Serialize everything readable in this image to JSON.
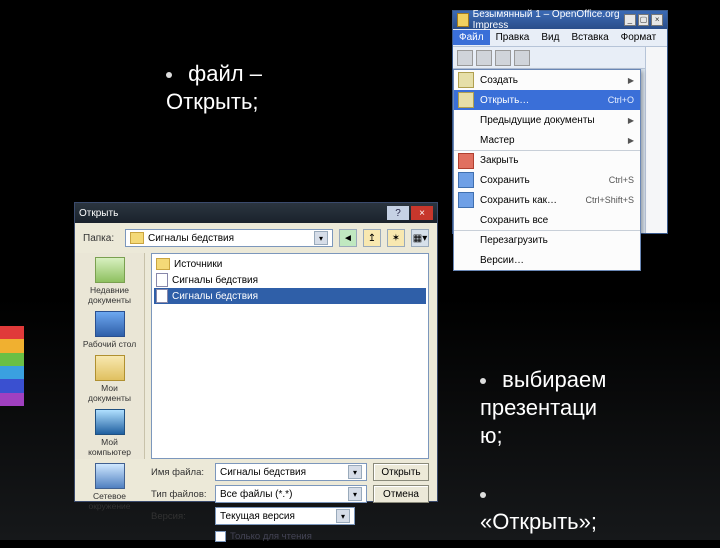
{
  "bullets": {
    "top_line1": "файл –",
    "top_line2": "Открыть;",
    "bottom1_line1": "выбираем",
    "bottom1_line2": "презентаци",
    "bottom1_line3": "ю;",
    "bottom2": "«Открыть»;"
  },
  "app": {
    "title": "Безымянный 1 – OpenOffice.org Impress",
    "menubar": [
      "Файл",
      "Правка",
      "Вид",
      "Вставка",
      "Формат"
    ],
    "menu": {
      "create": "Создать",
      "open": "Открыть…",
      "open_accel": "Ctrl+O",
      "recent": "Предыдущие документы",
      "wizard": "Мастер",
      "close": "Закрыть",
      "save": "Сохранить",
      "save_accel": "Ctrl+S",
      "save_as": "Сохранить как…",
      "save_as_accel": "Ctrl+Shift+S",
      "save_all": "Сохранить все",
      "reload": "Перезагрузить",
      "versions": "Версии…"
    }
  },
  "dialog": {
    "title": "Открыть",
    "folder_label": "Папка:",
    "folder_value": "Сигналы бедствия",
    "files": {
      "f0": "Источники",
      "f1": "Сигналы бедствия",
      "f2": "Сигналы бедствия"
    },
    "places": {
      "recent": "Недавние документы",
      "desktop": "Рабочий стол",
      "mydocs": "Мои документы",
      "mycomp": "Мой компьютер",
      "network": "Сетевое окружение"
    },
    "name_label": "Имя файла:",
    "name_value": "Сигналы бедствия",
    "type_label": "Тип файлов:",
    "type_value": "Все файлы (*.*)",
    "version_label": "Версия:",
    "version_value": "Текущая версия",
    "readonly": "Только для чтения",
    "open_btn": "Открыть",
    "cancel_btn": "Отмена"
  }
}
